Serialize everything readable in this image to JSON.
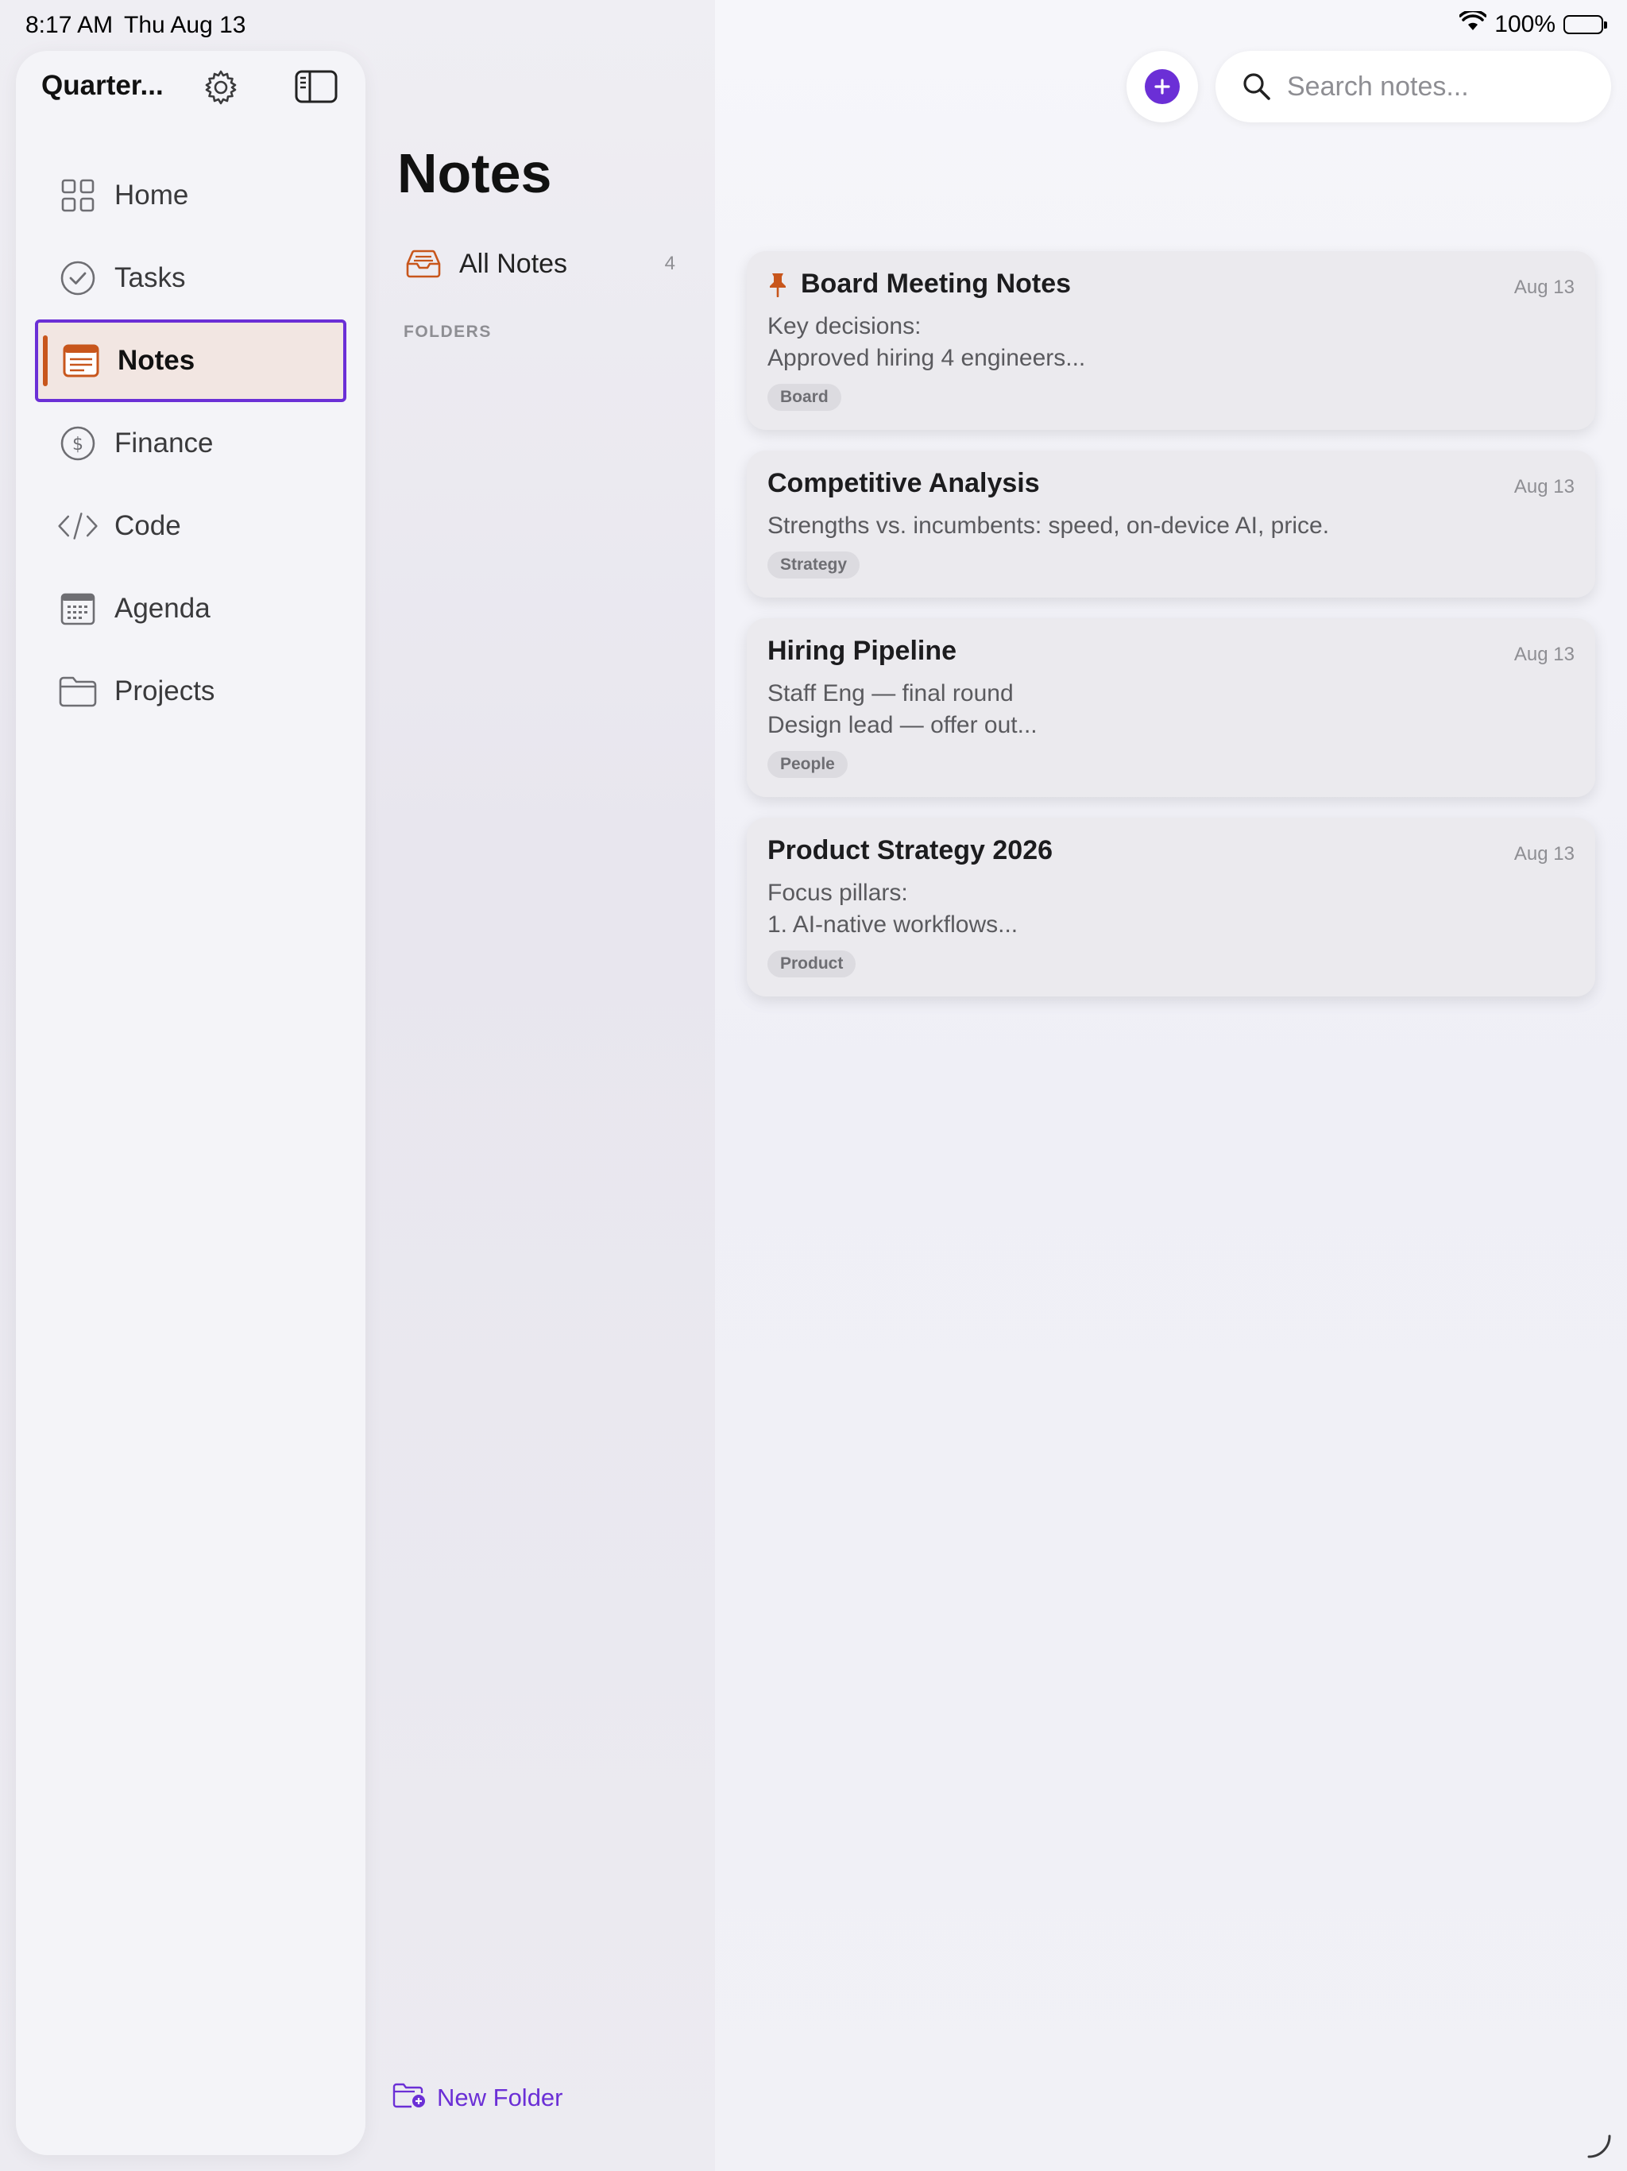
{
  "status_bar": {
    "time": "8:17 AM",
    "date": "Thu Aug 13",
    "battery": "100%"
  },
  "sidebar": {
    "title": "Quarter...",
    "items": [
      {
        "label": "Home",
        "icon": "grid-icon"
      },
      {
        "label": "Tasks",
        "icon": "checkmark-circle-icon"
      },
      {
        "label": "Notes",
        "icon": "note-icon",
        "active": true
      },
      {
        "label": "Finance",
        "icon": "dollar-circle-icon"
      },
      {
        "label": "Code",
        "icon": "code-icon"
      },
      {
        "label": "Agenda",
        "icon": "calendar-icon"
      },
      {
        "label": "Projects",
        "icon": "folder-icon"
      }
    ]
  },
  "notes_panel": {
    "title": "Notes",
    "all_notes_label": "All Notes",
    "all_notes_count": "4",
    "folders_header": "FOLDERS",
    "new_folder_label": "New Folder"
  },
  "search": {
    "placeholder": "Search notes..."
  },
  "notes": [
    {
      "title": "Board Meeting Notes",
      "date": "Aug 13",
      "line1": "Key decisions:",
      "line2": "Approved hiring 4 engineers...",
      "tag": "Board",
      "pinned": true
    },
    {
      "title": "Competitive Analysis",
      "date": "Aug 13",
      "line1": "Strengths vs. incumbents: speed, on-device AI, price.",
      "line2": "",
      "tag": "Strategy",
      "pinned": false
    },
    {
      "title": "Hiring Pipeline",
      "date": "Aug 13",
      "line1": "Staff Eng — final round",
      "line2": "Design lead — offer out...",
      "tag": "People",
      "pinned": false
    },
    {
      "title": "Product Strategy 2026",
      "date": "Aug 13",
      "line1": "Focus pillars:",
      "line2": "1. AI-native workflows...",
      "tag": "Product",
      "pinned": false
    }
  ],
  "colors": {
    "accent": "#6b2fd6",
    "notes_orange": "#c8561c",
    "active_bg": "#f2e6e2"
  }
}
